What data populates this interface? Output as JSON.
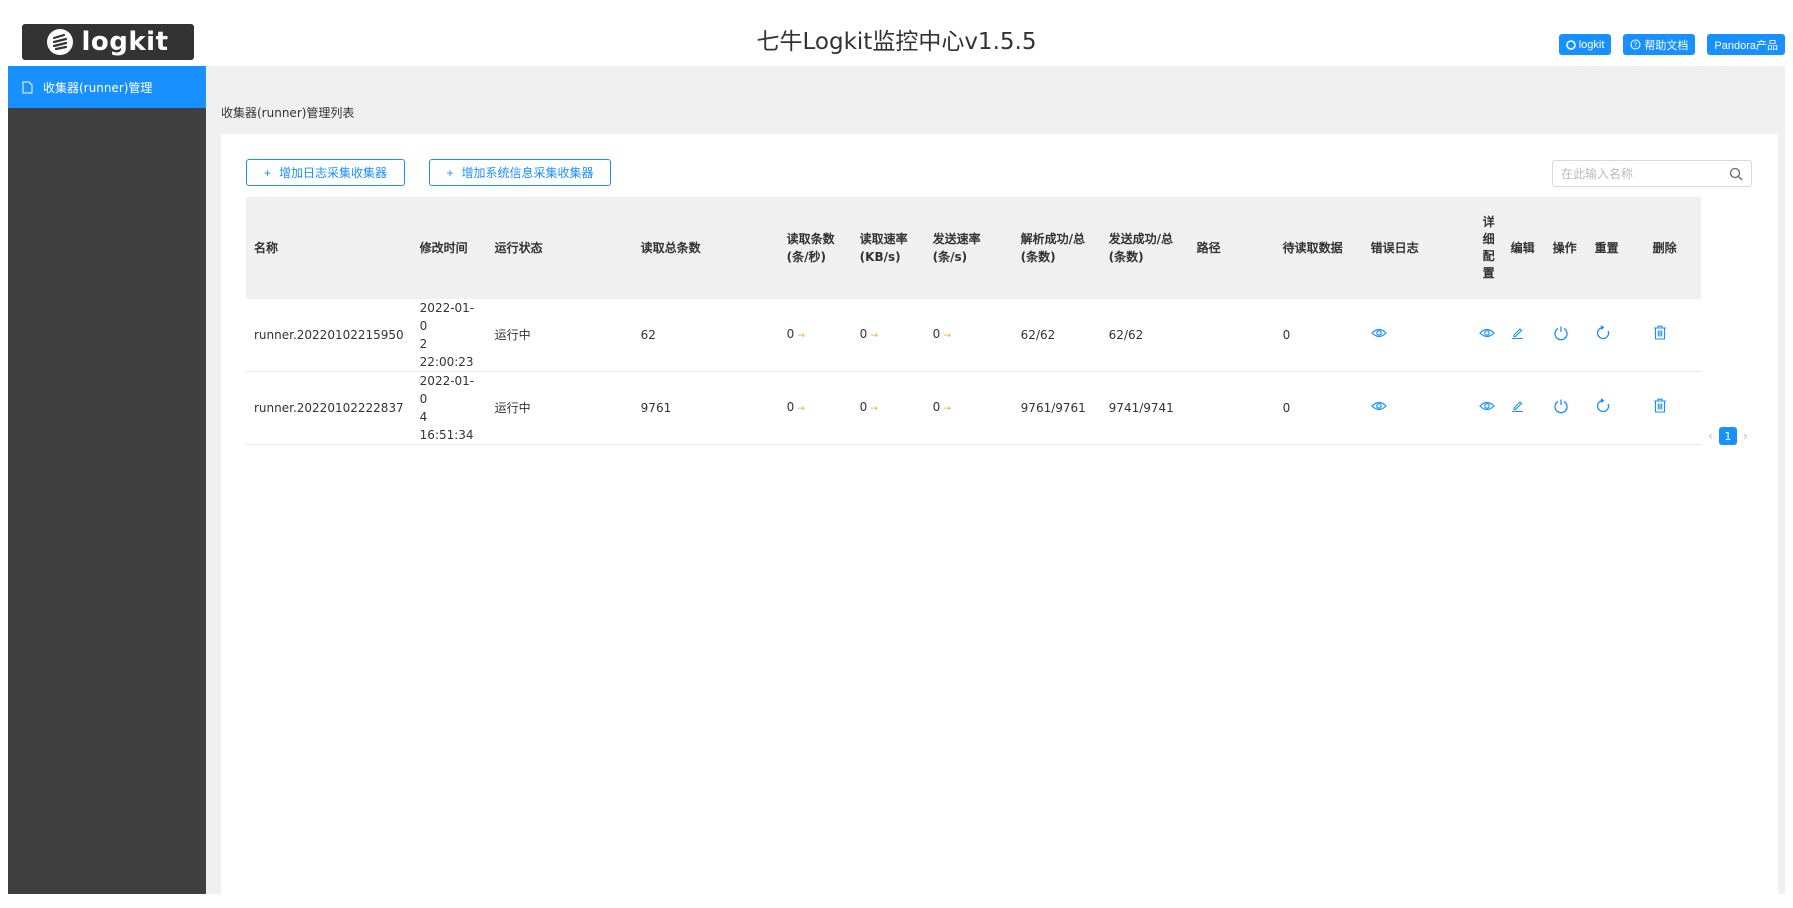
{
  "header": {
    "logo_text": "logkit",
    "title": "七牛Logkit监控中心v1.5.5",
    "buttons": [
      {
        "label": "logkit",
        "icon": "github-icon"
      },
      {
        "label": "帮助文档",
        "icon": "help-circle-icon"
      },
      {
        "label": "Pandora产品",
        "icon": ""
      }
    ]
  },
  "sidebar": {
    "items": [
      {
        "label": "收集器(runner)管理",
        "icon": "file-icon",
        "active": true
      }
    ]
  },
  "breadcrumb": "收集器(runner)管理列表",
  "toolbar": {
    "add_log_label": "增加日志采集收集器",
    "add_sys_label": "增加系统信息采集收集器",
    "search_placeholder": "在此输入名称"
  },
  "table": {
    "headers": {
      "name": "名称",
      "modified": "修改时间",
      "status": "运行状态",
      "total_read": "读取总条数",
      "read_count": "读取条数(条/秒)",
      "read_rate": "读取速率(KB/s)",
      "send_rate": "发送速率(条/s)",
      "parse_ok": "解析成功/总(条数)",
      "send_ok": "发送成功/总(条数)",
      "path": "路径",
      "pending": "待读取数据",
      "error_log": "错误日志",
      "detail": "详\n细\n配\n置",
      "edit": "编辑",
      "op": "操作",
      "reset": "重置",
      "delete": "删除"
    },
    "rows": [
      {
        "name": "runner.20220102215950",
        "modified_date": "2022-01-0",
        "modified_time": "2 22:00:23",
        "status": "运行中",
        "total_read": "62",
        "read_count": "0",
        "read_rate": "0",
        "send_rate": "0",
        "parse_ok": "62/62",
        "send_ok": "62/62",
        "path": "",
        "pending": "0"
      },
      {
        "name": "runner.20220102222837",
        "modified_date": "2022-01-0",
        "modified_time": "4 16:51:34",
        "status": "运行中",
        "total_read": "9761",
        "read_count": "0",
        "read_rate": "0",
        "send_rate": "0",
        "parse_ok": "9761/9761",
        "send_ok": "9741/9741",
        "path": "",
        "pending": "0"
      }
    ]
  },
  "pagination": {
    "current": "1",
    "prev": "‹",
    "next": "›"
  },
  "colors": {
    "accent": "#1890ff",
    "sidebar": "#404040",
    "rate_arrow": "#f5a623"
  }
}
